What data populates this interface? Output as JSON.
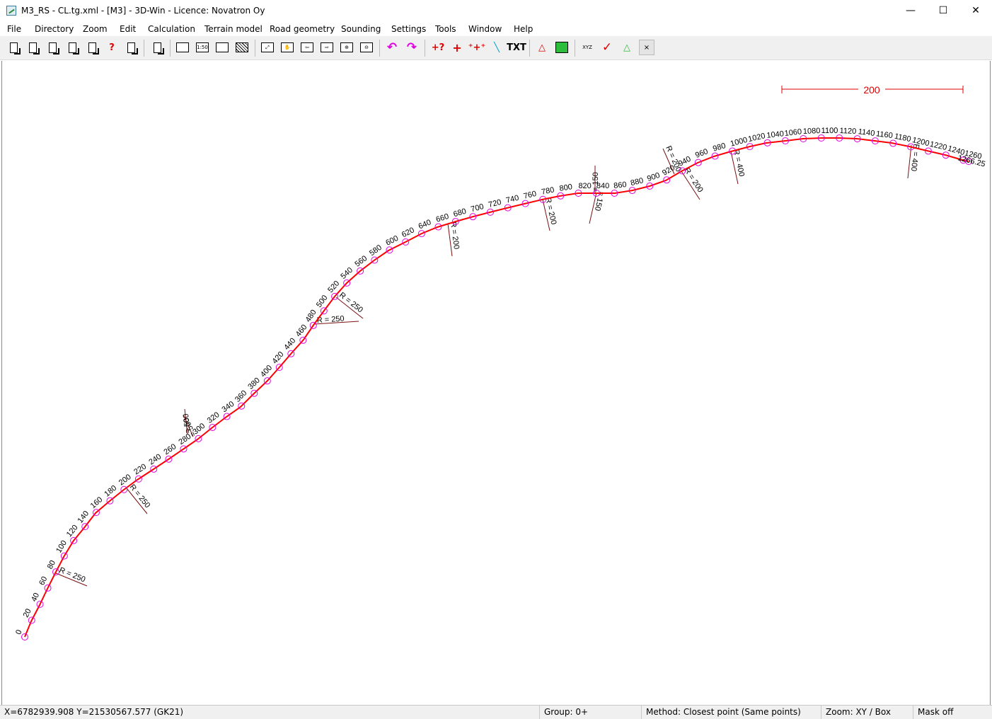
{
  "window": {
    "title": "M3_RS - CL.tg.xml - [M3] - 3D-Win - Licence: Novatron Oy",
    "minimize_glyph": "—",
    "maximize_glyph": "☐",
    "close_glyph": "✕"
  },
  "menu": [
    "File",
    "Directory",
    "Zoom",
    "Edit",
    "Calculation",
    "Terrain model",
    "Road geometry",
    "Sounding",
    "Settings",
    "Tools",
    "Window",
    "Help"
  ],
  "toolbar": {
    "zoom_scale_label": "1:50",
    "text_label": "TXT",
    "xyz_label": "XYZ",
    "icons": [
      "open-file-icon",
      "save-file-icon",
      "copy-files-icon",
      "export-icon",
      "import-icon",
      "query-icon",
      "send-icon",
      "clipboard-icon",
      "print-icon",
      "scale-print-icon",
      "print-frame-icon",
      "print-hatch-icon",
      "zoom-all-icon",
      "zoom-pan-icon",
      "zoom-left-icon",
      "zoom-right-icon",
      "zoom-in-icon",
      "zoom-out-icon",
      "undo-icon",
      "redo-icon",
      "point-query-icon",
      "add-point-icon",
      "multi-point-icon",
      "line-icon",
      "text-icon",
      "triangle-icon",
      "area-icon",
      "coordinate-icon",
      "check-icon",
      "numbering-icon",
      "labels-icon"
    ],
    "colors": {
      "magenta": "#e000e0",
      "red": "#e00000",
      "green": "#2dbd3c"
    }
  },
  "drawing": {
    "scale_bar_label": "200",
    "alignment_color": "#ff0000",
    "marker_color": "#e000e0",
    "stations": [
      "0",
      "20",
      "40",
      "60",
      "80",
      "100",
      "120",
      "140",
      "160",
      "180",
      "200",
      "220",
      "240",
      "260",
      "280",
      "300",
      "320",
      "340",
      "360",
      "380",
      "400",
      "420",
      "440",
      "460",
      "480",
      "500",
      "520",
      "540",
      "560",
      "580",
      "600",
      "620",
      "640",
      "660",
      "680",
      "700",
      "720",
      "740",
      "760",
      "780",
      "800",
      "820",
      "840",
      "860",
      "880",
      "900",
      "920",
      "940",
      "960",
      "980",
      "1000",
      "1020",
      "1040",
      "1060",
      "1080",
      "1100",
      "1120",
      "1140",
      "1160",
      "1180",
      "1200",
      "1220",
      "1240",
      "1260"
    ],
    "end_station": "1266.25",
    "radius_labels": [
      "R = 250",
      "R = 250",
      "= 500",
      "= 500",
      "R = 250",
      "R = 250",
      "R = 200",
      "R = 200",
      "= 150",
      "= 150",
      "R = 200",
      "R = 200",
      "R = 400",
      "R = 400"
    ]
  },
  "status": {
    "coordinates": "X=6782939.908  Y=21530567.577   (GK21)",
    "group": "Group: 0+",
    "method": "Method: Closest point (Same points)",
    "zoom": "Zoom: XY  /  Box",
    "mask": "Mask off"
  }
}
